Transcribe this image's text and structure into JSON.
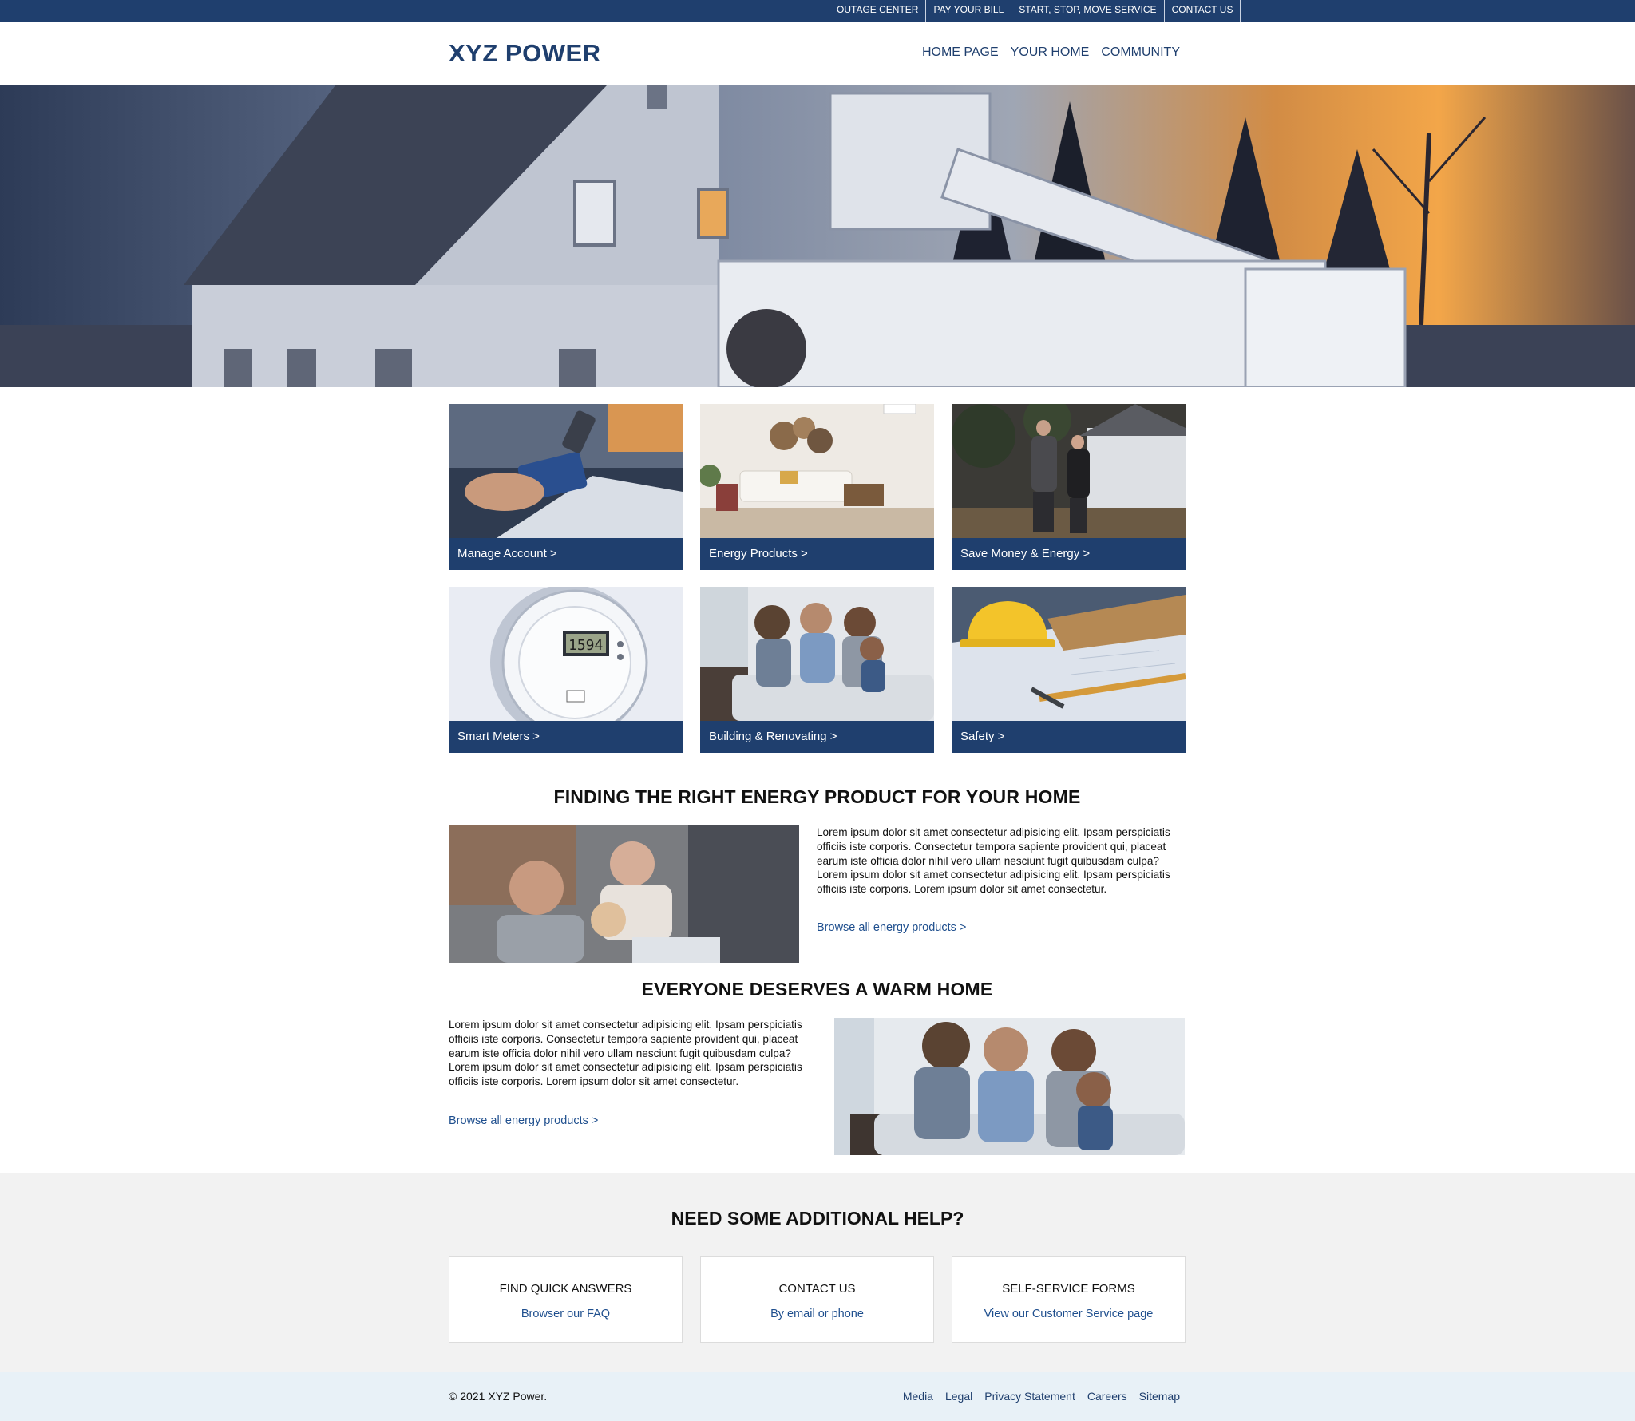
{
  "utility_nav": [
    "OUTAGE CENTER",
    "PAY YOUR BILL",
    "START, STOP, MOVE SERVICE",
    "CONTACT US"
  ],
  "header": {
    "logo": "XYZ POWER",
    "nav": [
      "HOME PAGE",
      "YOUR HOME",
      "COMMUNITY"
    ]
  },
  "tiles": [
    {
      "label": "Manage Account >",
      "image": "hand holding credit card over laptop"
    },
    {
      "label": "Energy Products >",
      "image": "bright living room"
    },
    {
      "label": "Save Money & Energy >",
      "image": "couple walking outside house"
    },
    {
      "label": "Smart Meters >",
      "image": "electric smart meter"
    },
    {
      "label": "Building & Renovating >",
      "image": "family on couch"
    },
    {
      "label": "Safety >",
      "image": "hard hat on blueprints"
    }
  ],
  "section1": {
    "title": "FINDING THE RIGHT ENERGY PRODUCT FOR YOUR HOME",
    "body": "Lorem ipsum dolor sit amet consectetur adipisicing elit. Ipsam perspiciatis officiis iste corporis. Consectetur tempora sapiente provident qui, placeat earum iste officia dolor nihil vero ullam nesciunt fugit quibusdam culpa? Lorem ipsum dolor sit amet consectetur adipisicing elit. Ipsam perspiciatis officiis iste corporis. Lorem ipsum dolor sit amet consectetur.",
    "link": "Browse all energy products >"
  },
  "section2": {
    "title": "EVERYONE DESERVES A WARM HOME",
    "body": "Lorem ipsum dolor sit amet consectetur adipisicing elit. Ipsam perspiciatis officiis iste corporis. Consectetur tempora sapiente provident qui, placeat earum iste officia dolor nihil vero ullam nesciunt fugit quibusdam culpa? Lorem ipsum dolor sit amet consectetur adipisicing elit. Ipsam perspiciatis officiis iste corporis. Lorem ipsum dolor sit amet consectetur.",
    "link": "Browse all energy products >"
  },
  "help": {
    "title": "NEED SOME ADDITIONAL HELP?",
    "cards": [
      {
        "title": "FIND QUICK ANSWERS",
        "link": "Browser our FAQ"
      },
      {
        "title": "CONTACT US",
        "link": "By email or phone"
      },
      {
        "title": "SELF-SERVICE FORMS",
        "link": "View our Customer Service page"
      }
    ]
  },
  "footer": {
    "copyright": "© 2021 XYZ Power.",
    "links": [
      "Media",
      "Legal",
      "Privacy Statement",
      "Careers",
      "Sitemap"
    ]
  },
  "colors": {
    "brand": "#1f3f6e",
    "link": "#1f4f8e",
    "help_bg": "#f2f2f2",
    "footer_bg": "#e8f1f7"
  }
}
